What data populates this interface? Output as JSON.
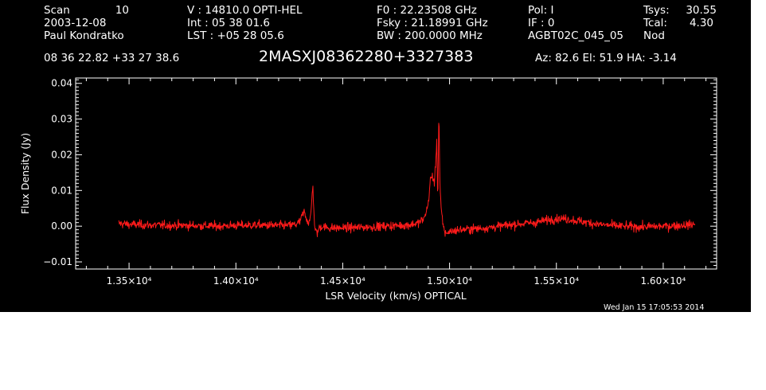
{
  "header": {
    "col1": [
      "Scan",
      "2003-12-08",
      "Paul Kondratko"
    ],
    "col1_value": "10",
    "col2": [
      "V   :    14810.0 OPTI-HEL",
      "Int  :  05 38 01.6",
      "LST : +05 28 05.6"
    ],
    "col3": [
      "F0    :  22.23508 GHz",
      "Fsky :  21.18991 GHz",
      "BW    : 200.0000 MHz"
    ],
    "col4": [
      "Pol:       I",
      "IF :       0",
      "AGBT02C_045_05"
    ],
    "col5_labels": [
      "Tsys:",
      "Tcal:",
      "Nod"
    ],
    "col5_values": [
      "30.55",
      "4.30",
      ""
    ],
    "coords": "08 36 22.82   +33 27 38.6",
    "source": "2MASXJ08362280+3327383",
    "az_el_ha": "Az:  82.6   El:  51.9   HA: -3.14"
  },
  "timestamp": "Wed Jan 15 17:05:53 2014",
  "colors": {
    "background": "#000000",
    "foreground": "#ffffff",
    "trace": "#ff1a1a"
  },
  "chart_data": {
    "type": "line",
    "xlabel": "LSR Velocity (km/s) OPTICAL",
    "ylabel": "Flux Density (Jy)",
    "xlim": [
      13250,
      16250
    ],
    "ylim": [
      -0.012,
      0.0415
    ],
    "xticks": [
      13500,
      14000,
      14500,
      15000,
      15500,
      16000
    ],
    "xtick_labels": [
      "1.35×10⁴",
      "1.40×10⁴",
      "1.45×10⁴",
      "1.50×10⁴",
      "1.55×10⁴",
      "1.60×10⁴"
    ],
    "yticks": [
      -0.01,
      0.0,
      0.01,
      0.02,
      0.03,
      0.04
    ],
    "ytick_labels": [
      "−0.01",
      "0.00",
      "0.01",
      "0.02",
      "0.03",
      "0.04"
    ],
    "grid": false,
    "series": [
      {
        "x": [
          13450,
          13500,
          13600,
          13700,
          13800,
          13900,
          14000,
          14100,
          14200,
          14250,
          14280,
          14300,
          14310,
          14320,
          14330,
          14340,
          14350,
          14355,
          14360,
          14365,
          14370,
          14380,
          14390,
          14400,
          14420,
          14440,
          14500,
          14600,
          14700,
          14800,
          14850,
          14880,
          14900,
          14910,
          14920,
          14930,
          14940,
          14945,
          14950,
          14955,
          14960,
          14970,
          14980,
          15000,
          15050,
          15100,
          15200,
          15300,
          15400,
          15500,
          15550,
          15600,
          15700,
          15800,
          15900,
          16000,
          16100,
          16150
        ],
        "y": [
          0.0008,
          0.0005,
          0.0003,
          0.0002,
          0.0002,
          0.0,
          0.0002,
          0.0003,
          0.0002,
          0.0002,
          0.0005,
          0.0012,
          0.003,
          0.004,
          0.0022,
          0.001,
          0.0025,
          0.007,
          0.012,
          0.004,
          -0.001,
          -0.002,
          -0.0005,
          0.0,
          -0.0003,
          -0.0005,
          -0.0005,
          -0.0003,
          0.0,
          0.0003,
          0.0008,
          0.002,
          0.006,
          0.013,
          0.014,
          0.012,
          0.024,
          0.007,
          0.0325,
          0.012,
          0.005,
          0.0,
          -0.002,
          -0.0015,
          -0.001,
          -0.0008,
          -0.0003,
          0.0005,
          0.001,
          0.0022,
          0.002,
          0.0015,
          0.0005,
          0.0,
          -0.0002,
          0.0,
          0.0003,
          0.0005
        ],
        "noise_rms": 0.0006
      }
    ]
  }
}
